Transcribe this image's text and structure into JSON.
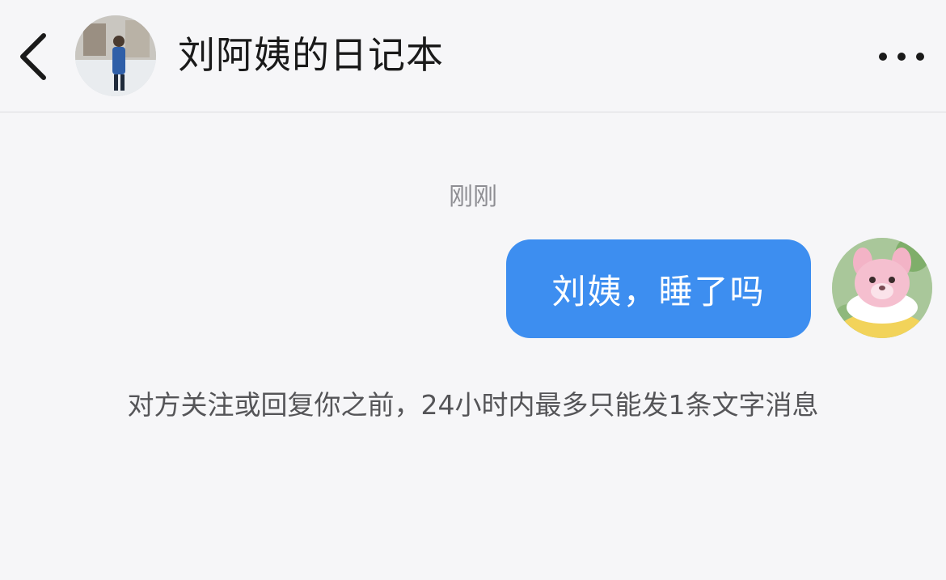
{
  "header": {
    "back_icon": "chevron-left-icon",
    "title": "刘阿姨的日记本",
    "more_icon": "more-horizontal-icon"
  },
  "conversation": {
    "timestamp": "刚刚",
    "messages": [
      {
        "sender": "me",
        "text": "刘姨，睡了吗"
      }
    ],
    "notice": "对方关注或回复你之前，24小时内最多只能发1条文字消息"
  },
  "colors": {
    "background": "#f6f6f8",
    "bubble": "#3d8ef0",
    "bubble_text": "#ffffff",
    "title_text": "#1a1a1a",
    "muted_text": "#8e8e93"
  }
}
